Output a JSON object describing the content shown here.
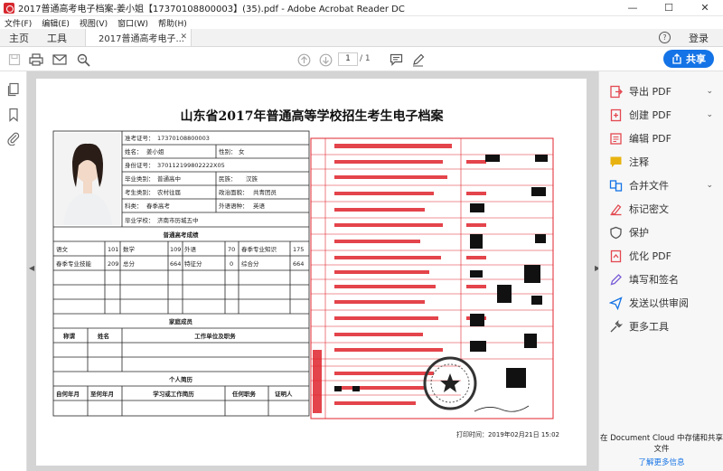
{
  "window": {
    "title": "2017普通高考电子档案-姜小姐【17370108800003】(35).pdf - Adobe Acrobat Reader DC",
    "minimize": "—",
    "maximize": "☐",
    "close": "✕"
  },
  "menu": [
    "文件(F)",
    "编辑(E)",
    "视图(V)",
    "窗口(W)",
    "帮助(H)"
  ],
  "tabs": {
    "home": "主页",
    "tools": "工具",
    "document": "2017普通高考电子...",
    "help": "?",
    "login": "登录"
  },
  "toolbar": {
    "page_current": "1",
    "page_total": "/ 1",
    "share_label": "共享"
  },
  "document": {
    "title": "山东省2017年普通高等学校招生考生电子档案",
    "info_rows": [
      {
        "label": "准考证号：",
        "value": "17370108800003"
      },
      {
        "label": "姓名：",
        "value": "姜小姐",
        "label2": "性别：",
        "value2": "女"
      },
      {
        "label": "身份证号：",
        "value": "370112199802222X05"
      },
      {
        "label": "毕业类别：",
        "value": "普通高中",
        "label2": "民族：",
        "value2": "汉族"
      },
      {
        "label": "考生类别：",
        "value": "农村往届",
        "label2": "政治面貌：",
        "value2": "共青团员"
      },
      {
        "label": "科类：",
        "value": "春季高考",
        "label2": "外语语种：",
        "value2": "英语"
      },
      {
        "label": "毕业学校：",
        "value": "济南市历城五中"
      }
    ],
    "scores_title": "普通高考成绩",
    "scores_row1": [
      "语文",
      "101",
      "数学",
      "109",
      "外语",
      "70",
      "春季专业知识",
      "175"
    ],
    "scores_row2": [
      "春季专业技能",
      "209",
      "总分",
      "664",
      "特征分",
      "0",
      "综合分",
      "664"
    ],
    "family_title": "家庭成员",
    "family_headers": [
      "称谓",
      "姓名",
      "工作单位及职务"
    ],
    "resume_title": "个人简历",
    "resume_headers": [
      "自何年月",
      "至何年月",
      "学习或工作简历",
      "任何职务",
      "证明人"
    ],
    "print_time": "打印时间：2019年02月21日 15:02"
  },
  "tools": [
    {
      "label": "导出 PDF",
      "icon": "export-pdf-icon",
      "chevron": true,
      "color": "#e34850"
    },
    {
      "label": "创建 PDF",
      "icon": "create-pdf-icon",
      "chevron": true,
      "color": "#e34850"
    },
    {
      "label": "编辑 PDF",
      "icon": "edit-pdf-icon",
      "chevron": false,
      "color": "#e34850"
    },
    {
      "label": "注释",
      "icon": "comment-icon",
      "chevron": false,
      "color": "#e8b310"
    },
    {
      "label": "合并文件",
      "icon": "combine-icon",
      "chevron": true,
      "color": "#1473e6"
    },
    {
      "label": "标记密文",
      "icon": "redact-icon",
      "chevron": false,
      "color": "#e34850"
    },
    {
      "label": "保护",
      "icon": "protect-icon",
      "chevron": false,
      "color": "#555555"
    },
    {
      "label": "优化 PDF",
      "icon": "optimize-icon",
      "chevron": false,
      "color": "#e34850"
    },
    {
      "label": "填写和签名",
      "icon": "fill-sign-icon",
      "chevron": false,
      "color": "#7a5cd6"
    },
    {
      "label": "发送以供审阅",
      "icon": "send-review-icon",
      "chevron": false,
      "color": "#1473e6"
    },
    {
      "label": "更多工具",
      "icon": "more-tools-icon",
      "chevron": false,
      "color": "#555555"
    }
  ],
  "cloud": {
    "text": "在 Document Cloud 中存储和共享文件",
    "learn_more": "了解更多信息"
  },
  "colors": {
    "accent": "#1473e6",
    "brand_red": "#d7282f",
    "form_red": "#e0242c"
  }
}
